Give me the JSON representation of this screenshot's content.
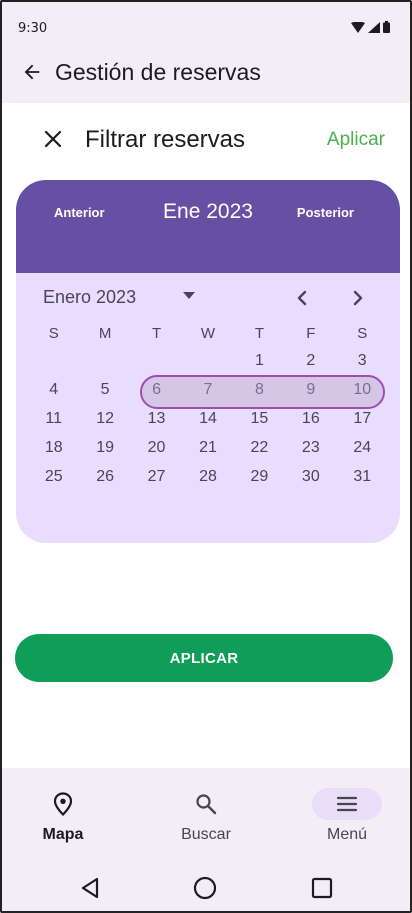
{
  "status_bar": {
    "time": "9:30"
  },
  "app_bar": {
    "title": "Gestión de reservas"
  },
  "filter": {
    "title": "Filtrar reservas",
    "apply_link": "Aplicar"
  },
  "calendar": {
    "header": {
      "prev": "Anterior",
      "month": "Ene 2023",
      "next": "Posterior"
    },
    "month_label": "Enero 2023",
    "weekdays": [
      "S",
      "M",
      "T",
      "W",
      "T",
      "F",
      "S"
    ],
    "weeks": [
      [
        "",
        "",
        "",
        "",
        "1",
        "2",
        "3"
      ],
      [
        "4",
        "5",
        "6",
        "7",
        "8",
        "9",
        "10"
      ],
      [
        "11",
        "12",
        "13",
        "14",
        "15",
        "16",
        "17"
      ],
      [
        "18",
        "19",
        "20",
        "21",
        "22",
        "23",
        "24"
      ],
      [
        "25",
        "26",
        "27",
        "28",
        "29",
        "30",
        "31"
      ]
    ],
    "selected_range": [
      "6",
      "10"
    ]
  },
  "apply_button": {
    "label": "APLICAR"
  },
  "bottom_nav": {
    "items": [
      {
        "label": "Mapa",
        "icon": "location-pin-icon",
        "active": true
      },
      {
        "label": "Buscar",
        "icon": "search-icon",
        "active": false
      },
      {
        "label": "Menú",
        "icon": "menu-icon",
        "active": false
      }
    ]
  },
  "colors": {
    "primary": "#6750a4",
    "calendar_bg": "#e9ddff",
    "apply_green": "#0f9d58",
    "apply_link_green": "#4caf50",
    "range_border": "#9c4fb0"
  }
}
